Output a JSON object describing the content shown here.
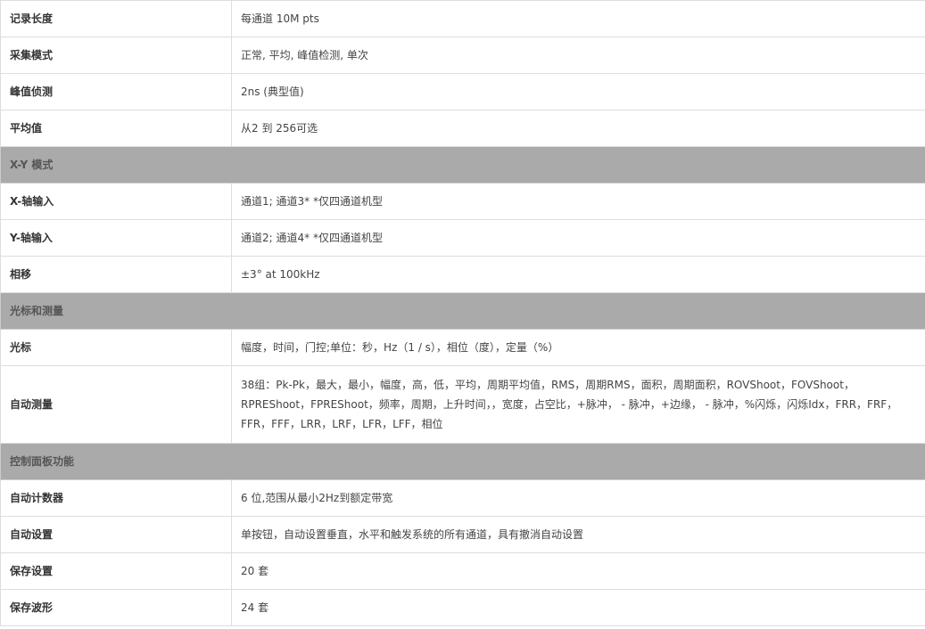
{
  "spec_table": {
    "rows": [
      {
        "label": "记录长度",
        "value": "每通道 10M pts"
      },
      {
        "label": "采集模式",
        "value": "正常, 平均, 峰值检测, 单次"
      },
      {
        "label": "峰值侦测",
        "value": "2ns (典型值)"
      },
      {
        "label": "平均值",
        "value": "从2 到 256可选"
      },
      {
        "section": "X-Y 模式"
      },
      {
        "label": "X-轴输入",
        "value": "通道1; 通道3*  *仅四通道机型"
      },
      {
        "label": "Y-轴输入",
        "value": "通道2; 通道4*  *仅四通道机型"
      },
      {
        "label": "相移",
        "value": "±3° at 100kHz"
      },
      {
        "section": "光标和测量"
      },
      {
        "label": "光标",
        "value": "幅度，时间，门控;单位：秒，Hz（1 / s），相位（度），定量（%）"
      },
      {
        "label": "自动测量",
        "value": "38组：Pk-Pk，最大，最小，幅度，高，低，平均，周期平均值，RMS，周期RMS，面积，周期面积，ROVShoot，FOVShoot，RPREShoot，FPREShoot，频率，周期，上升时间，，宽度，占空比，+脉冲， - 脉冲，+边缘， - 脉冲，%闪烁，闪烁Idx，FRR，FRF，FFR，FFF，LRR，LRF，LFR，LFF，相位"
      },
      {
        "section": "控制面板功能"
      },
      {
        "label": "自动计数器",
        "value": "6 位,范围从最小2Hz到额定带宽"
      },
      {
        "label": "自动设置",
        "value": "单按钮，自动设置垂直，水平和触发系统的所有通道，具有撤消自动设置"
      },
      {
        "label": "保存设置",
        "value": "20 套"
      },
      {
        "label": "保存波形",
        "value": "24 套"
      }
    ]
  }
}
